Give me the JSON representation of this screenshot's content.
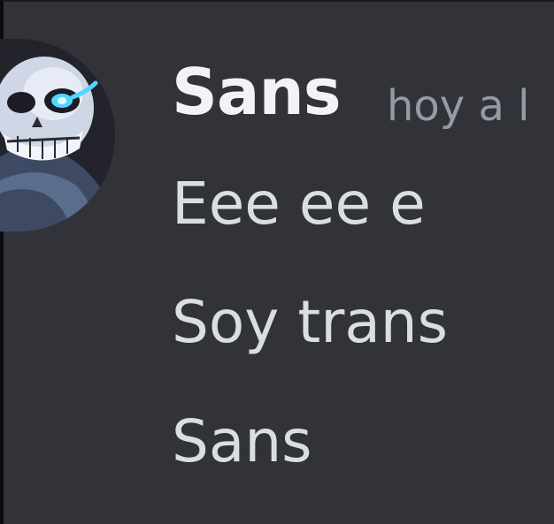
{
  "message": {
    "author": "Sans",
    "timestamp": "hoy a l",
    "lines": [
      "Eee ee e",
      "Soy trans",
      "Sans"
    ]
  },
  "avatar": {
    "icon": "skull-avatar-icon",
    "eye_color": "#4fd8ff"
  },
  "colors": {
    "background": "#313338",
    "author": "#f2f3f5",
    "timestamp": "#949ba4",
    "text": "#dbdee1"
  }
}
